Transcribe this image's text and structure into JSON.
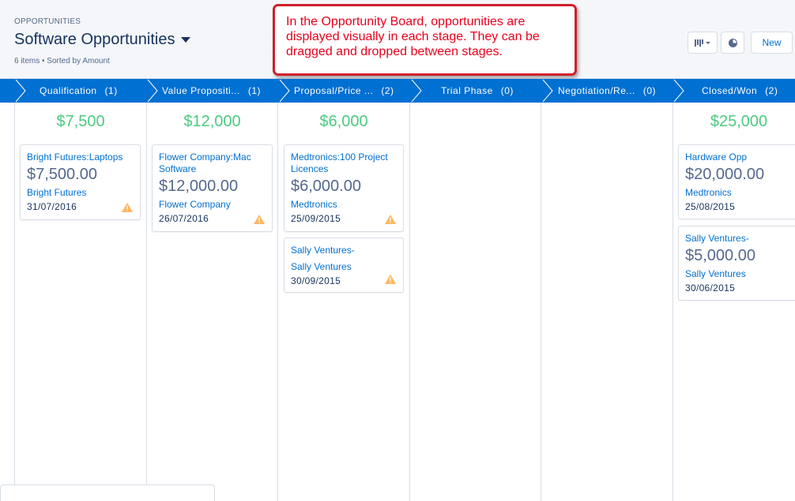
{
  "header": {
    "object_label": "OPPORTUNITIES",
    "list_title": "Software Opportunities",
    "meta": "6 items • Sorted by Amount",
    "new_button": "New"
  },
  "callout": {
    "text": "In the Opportunity Board, opportunities are displayed visually in each stage. They can be dragged and dropped between stages."
  },
  "stages": [
    {
      "name": "Qualification",
      "count": "(1)",
      "total": "$7,500"
    },
    {
      "name": "Value Propositi...",
      "count": "(1)",
      "total": "$12,000"
    },
    {
      "name": "Proposal/Price ...",
      "count": "(2)",
      "total": "$6,000"
    },
    {
      "name": "Trial Phase",
      "count": "(0)",
      "total": ""
    },
    {
      "name": "Negotiation/Re...",
      "count": "(0)",
      "total": ""
    },
    {
      "name": "Closed/Won",
      "count": "(2)",
      "total": "$25,000"
    }
  ],
  "cards": [
    {
      "title": "Bright Futures:Laptops",
      "amount": "$7,500.00",
      "account": "Bright Futures",
      "date": "31/07/2016",
      "warning": true
    },
    {
      "title": "Flower Company:Mac Software",
      "amount": "$12,000.00",
      "account": "Flower Company",
      "date": "26/07/2016",
      "warning": true
    },
    {
      "title": "Medtronics:100 Project Licences",
      "amount": "$6,000.00",
      "account": "Medtronics",
      "date": "25/09/2015",
      "warning": true
    },
    {
      "title": "Sally Ventures-",
      "amount": "",
      "account": "Sally Ventures",
      "date": "30/09/2015",
      "warning": true
    },
    {
      "title": "Hardware Opp",
      "amount": "$20,000.00",
      "account": "Medtronics",
      "date": "25/08/2015",
      "warning": false
    },
    {
      "title": "Sally Ventures-",
      "amount": "$5,000.00",
      "account": "Sally Ventures",
      "date": "30/06/2015",
      "warning": false
    }
  ],
  "colors": {
    "stage_bar": "#0070d2",
    "total_green": "#4bca81",
    "link_blue": "#0070d2",
    "warning": "#ffb75d",
    "callout_red": "#e8001c"
  }
}
